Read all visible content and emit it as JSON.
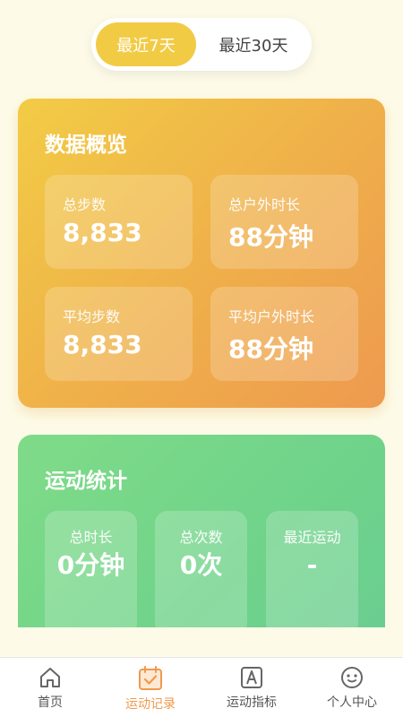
{
  "range_toggle": {
    "options": [
      {
        "label": "最近7天",
        "selected": true
      },
      {
        "label": "最近30天",
        "selected": false
      }
    ]
  },
  "overview": {
    "title": "数据概览",
    "tiles": [
      {
        "label": "总步数",
        "value": "8,833"
      },
      {
        "label": "总户外时长",
        "value": "88分钟"
      },
      {
        "label": "平均步数",
        "value": "8,833"
      },
      {
        "label": "平均户外时长",
        "value": "88分钟"
      }
    ]
  },
  "sport_stats": {
    "title": "运动统计",
    "tiles": [
      {
        "label": "总时长",
        "value": "0分钟"
      },
      {
        "label": "总次数",
        "value": "0次"
      },
      {
        "label": "最近运动",
        "value": "-"
      }
    ]
  },
  "tabbar": {
    "items": [
      {
        "label": "首页",
        "icon": "home-icon",
        "active": false
      },
      {
        "label": "运动记录",
        "icon": "calendar-check-icon",
        "active": true
      },
      {
        "label": "运动指标",
        "icon": "letter-a-icon",
        "active": false
      },
      {
        "label": "个人中心",
        "icon": "smiley-icon",
        "active": false
      }
    ]
  },
  "colors": {
    "accent_yellow": "#f2cb45",
    "active_tab": "#ef9a4d",
    "overview_gradient_start": "#f2cc45",
    "overview_gradient_end": "#ee9a4f",
    "sport_gradient": "#72d58a",
    "background": "#fdfbe8"
  }
}
